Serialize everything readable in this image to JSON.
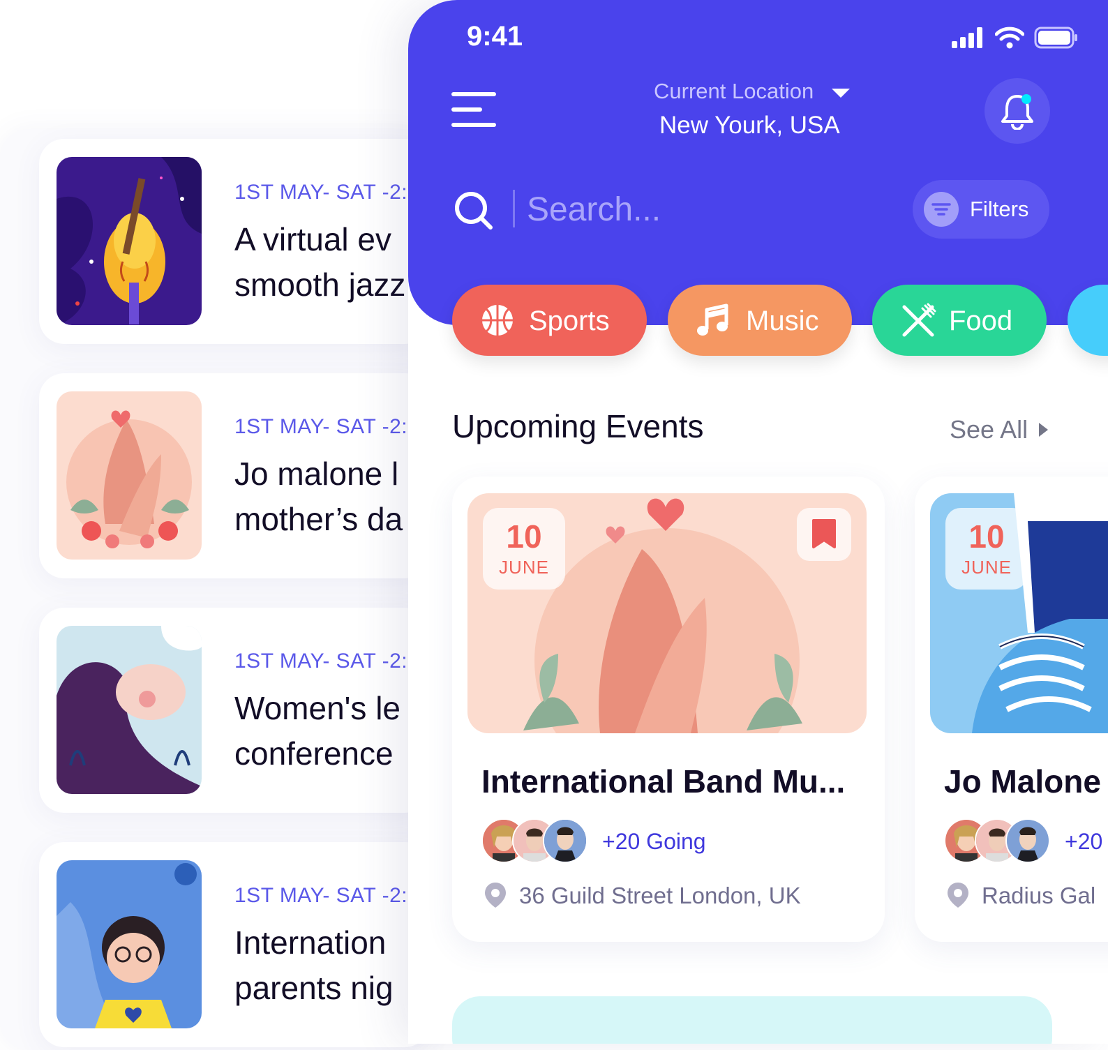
{
  "list_events": [
    {
      "date": "1ST  MAY- SAT -2:",
      "title": "A virtual ev\nsmooth jazz",
      "image": "guitar-illustration"
    },
    {
      "date": "1ST  MAY- SAT -2:",
      "title": "Jo malone l\nmother’s da",
      "image": "hands-illustration"
    },
    {
      "date": "1ST  MAY- SAT -2:",
      "title": "Women's le\nconference",
      "image": "woman-illustration"
    },
    {
      "date": "1ST  MAY- SAT -2:",
      "title": "Internation\nparents nig",
      "image": "girl-illustration"
    }
  ],
  "status_bar": {
    "time": "9:41"
  },
  "header": {
    "location_label": "Current Location",
    "location_value": "New Yourk, USA",
    "search_placeholder": "Search...",
    "filters_label": "Filters"
  },
  "categories": [
    {
      "label": "Sports",
      "color": "#f0635a",
      "icon": "basketball-icon"
    },
    {
      "label": "Music",
      "color": "#f59762",
      "icon": "music-note-icon"
    },
    {
      "label": "Food",
      "color": "#29d697",
      "icon": "fork-knife-icon"
    }
  ],
  "upcoming": {
    "title": "Upcoming Events",
    "see_all": "See All",
    "events": [
      {
        "day": "10",
        "month": "JUNE",
        "title": "International Band Mu...",
        "going": "+20 Going",
        "address": "36 Guild Street London, UK"
      },
      {
        "day": "10",
        "month": "JUNE",
        "title": "Jo Malone",
        "going": "+20",
        "address": "Radius Gal"
      }
    ]
  },
  "colors": {
    "primary": "#4a43ec",
    "accent": "#f0635a",
    "text_dark": "#120d26"
  }
}
